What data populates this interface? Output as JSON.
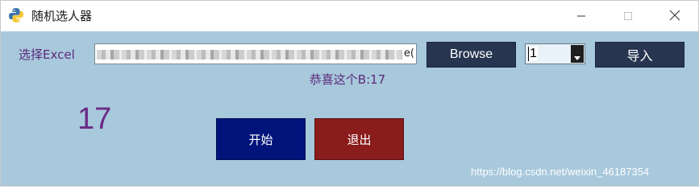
{
  "window": {
    "title": "随机选人器",
    "icon": "python-icon",
    "controls": [
      "minimize-icon",
      "maximize-icon",
      "close-icon"
    ]
  },
  "file_row": {
    "label": "选择Excel",
    "path_visible_tail": "e(",
    "browse_label": "Browse",
    "count_value": "1",
    "import_label": "导入"
  },
  "result": {
    "message": "恭喜这个B:17",
    "number": "17"
  },
  "actions": {
    "start_label": "开始",
    "exit_label": "退出"
  },
  "watermark": "https://blog.csdn.net/weixin_46187354",
  "colors": {
    "background": "#a8c8dc",
    "label_purple": "#5a2a7a",
    "dark_button": "#273550",
    "start_button": "#00147c",
    "exit_button": "#8a1c1c"
  }
}
